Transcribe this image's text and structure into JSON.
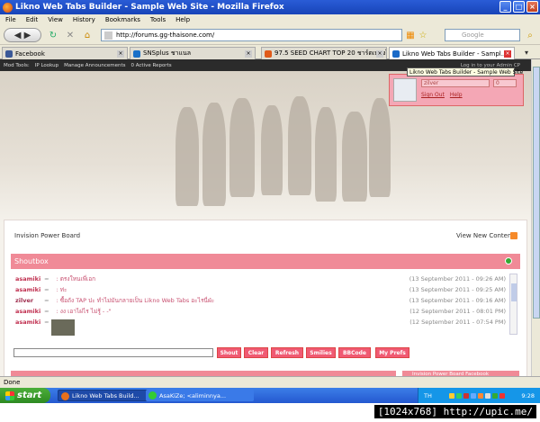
{
  "window": {
    "title": "Likno Web Tabs Builder - Sample Web Site - Mozilla Firefox",
    "btn_min": "_",
    "btn_max": "□",
    "btn_close": "×"
  },
  "menu": [
    "File",
    "Edit",
    "View",
    "History",
    "Bookmarks",
    "Tools",
    "Help"
  ],
  "nav": {
    "url": "http://forums.gg-thaisone.com/",
    "search_placeholder": "Google"
  },
  "tabs": [
    {
      "label": "Facebook",
      "color": "#3b5998"
    },
    {
      "label": "SNSplus ชาแนล",
      "color": "#1a70c8"
    },
    {
      "label": "97.5 SEED CHART TOP 20 ชาร์ตเพลงไ...",
      "color": "#e05a1a"
    },
    {
      "label": "Likno Web Tabs Builder - Sampl...",
      "color": "#1a6ac8"
    }
  ],
  "modbar": {
    "items": [
      "Mod Tools:",
      "IP Lookup",
      "Manage Announcements",
      "0 Active Reports"
    ],
    "login_hint": "Log in to your Admin CP"
  },
  "tooltip": "Likno Web Tabs Builder - Sample Web Site",
  "login": {
    "username": "zilver",
    "count": "0",
    "sign_out": "Sign Out",
    "help": "Help"
  },
  "board": {
    "crumb": "Invision Power Board",
    "view_new": "View New Content"
  },
  "shoutbox": {
    "title": "Shoutbox",
    "rows": [
      {
        "user": "asamiki",
        "msg": ": ตรงใหนเพี่เอก",
        "time": "(13 September 2011 - 09:26 AM)"
      },
      {
        "user": "asamiki",
        "msg": ": ท่ะ",
        "time": "(13 September 2011 - 09:25 AM)"
      },
      {
        "user": "zilver",
        "msg": ": ซื้อถัง TAP ปะ ทำไม่มันกลายเป็น Likno Web Tabs อะไรนี่ฝ่ะ",
        "time": "(13 September 2011 - 09:16 AM)"
      },
      {
        "user": "asamiki",
        "msg": ": งง เอาไฝไร ไม่รู้ - -\"",
        "time": "(12 September 2011 - 08:01 PM)"
      },
      {
        "user": "asamiki",
        "msg": "",
        "time": "(12 September 2011 - 07:54 PM)"
      }
    ],
    "buttons": [
      "Shout",
      "Clear",
      "Refresh",
      "Smilies",
      "BBCode",
      "My Prefs"
    ]
  },
  "sidebar_head": "Invision Power Board Facebook",
  "status": "Done",
  "taskbar": {
    "start": "start",
    "tasks": [
      {
        "label": "Likno Web Tabs Build...",
        "active": true
      },
      {
        "label": "AsaKiZe; <aliminnya...",
        "active": false
      }
    ],
    "lang": "TH",
    "clock": "9:28"
  },
  "watermark": "[1024x768] http://upic.me/"
}
